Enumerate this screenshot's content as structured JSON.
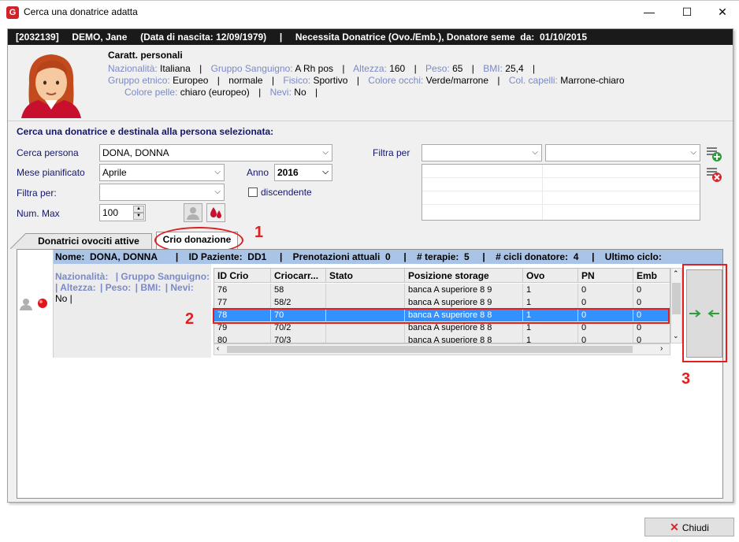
{
  "window": {
    "title": "Cerca una donatrice adatta",
    "logo": "G"
  },
  "header": {
    "id": "[2032139]",
    "name": "DEMO, Jane",
    "birth": "(Data di nascita: 12/09/1979)",
    "sep": "|",
    "need": "Necessita Donatrice (Ovo./Emb.), Donatore seme  da:  01/10/2015"
  },
  "patient": {
    "title": "Caratt. personali",
    "nationality_label": "Nazionalità:",
    "nationality": "Italiana",
    "blood_label": "Gruppo Sanguigno:",
    "blood": "A Rh pos",
    "height_label": "Altezza:",
    "height": "160",
    "weight_label": "Peso:",
    "weight": "65",
    "bmi_label": "BMI:",
    "bmi": "25,4",
    "ethnic_label": "Gruppo etnico:",
    "ethnic": "Europeo",
    "build": "normale",
    "physique_label": "Fisico:",
    "physique": "Sportivo",
    "eye_label": "Colore occhi:",
    "eye": "Verde/marrone",
    "hair_label": "Col. capelli:",
    "hair": "Marrone-chiaro",
    "skin_label": "Colore pelle:",
    "skin": "chiaro (europeo)",
    "moles_label": "Nevi:",
    "moles": "No",
    "sep": "|"
  },
  "search": {
    "title": "Cerca una donatrice e destinala alla persona selezionata:",
    "person_label": "Cerca persona",
    "person_value": "DONA, DONNA",
    "month_label": "Mese pianificato",
    "month_value": "Aprile",
    "year_label": "Anno",
    "year_value": "2016",
    "filter_label": "Filtra per:",
    "filter_value": "",
    "descending_label": "discendente",
    "max_label": "Num. Max",
    "max_value": "100",
    "filter_right_label": "Filtra per"
  },
  "tabs": [
    {
      "label": "Donatrici ovociti attive"
    },
    {
      "label": "Crio donazione"
    }
  ],
  "summary": {
    "text": "Nome:  DONA, DONNA       |    ID Paziente:  DD1     |    Prenotazioni attuali  0     |    # terapie:  5     |    # cicli donatore:  4     |    Ultimo ciclo:"
  },
  "donor_info": {
    "line1_a": "Nazionalità:",
    "line1_b": "| Gruppo Sanguigno:",
    "line2_a": "| Altezza:",
    "line2_b": "| Peso:",
    "line2_c": "| BMI:",
    "line2_d": "| Nevi:",
    "line3": "No   |"
  },
  "grid": {
    "columns": [
      "ID Crio",
      "Criocarr...",
      "Stato",
      "Posizione storage",
      "Ovo",
      "PN",
      "Emb"
    ],
    "rows": [
      [
        "76",
        "58",
        "",
        "banca A superiore 8 9",
        "1",
        "0",
        "0"
      ],
      [
        "77",
        "58/2",
        "",
        "banca A superiore 8 9",
        "1",
        "0",
        "0"
      ],
      [
        "78",
        "70",
        "",
        "banca A superiore 8 8",
        "1",
        "0",
        "0"
      ],
      [
        "79",
        "70/2",
        "",
        "banca A superiore 8 8",
        "1",
        "0",
        "0"
      ],
      [
        "80",
        "70/3",
        "",
        "banca A superiore 8 8",
        "1",
        "0",
        "0"
      ]
    ],
    "selected_index": 2
  },
  "annotations": {
    "a1": "1",
    "a2": "2",
    "a3": "3"
  },
  "buttons": {
    "close": "Chiudi"
  },
  "colors": {
    "accent_red": "#e02020",
    "selection": "#3390ff",
    "summary_bar": "#a9c4e6",
    "label_blue": "#7a8ac8"
  }
}
